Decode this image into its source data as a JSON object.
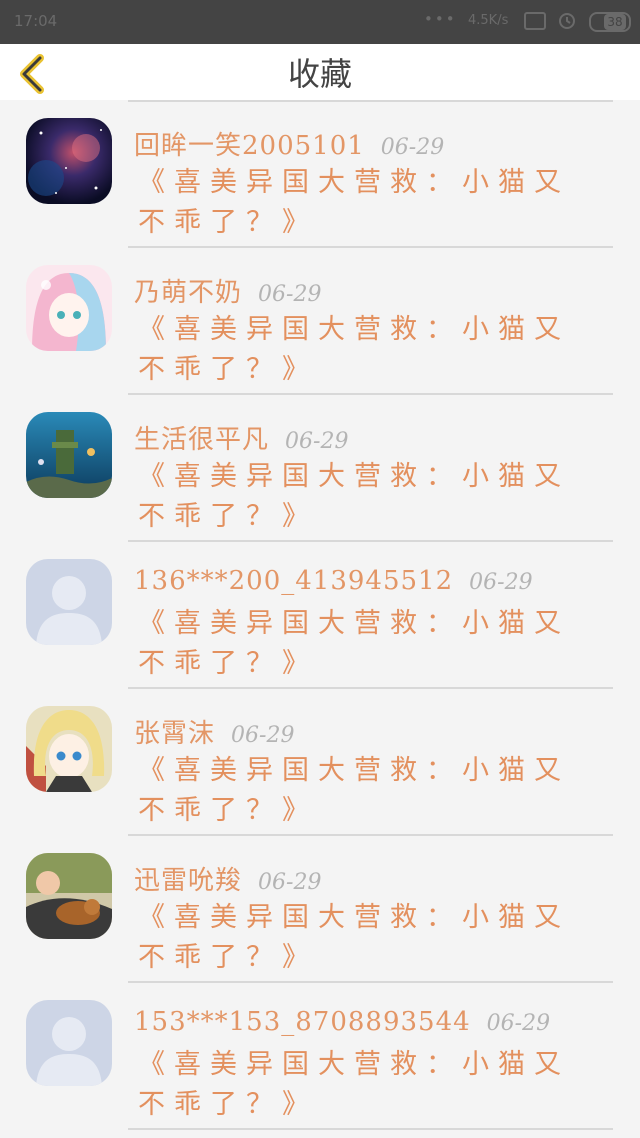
{
  "status": {
    "time": "17:04",
    "dots": "•••",
    "speed": "4.5K/s",
    "battery": "38"
  },
  "header": {
    "title": "收藏"
  },
  "items": [
    {
      "username": "回眸一笑2005101",
      "date": "06-29",
      "content": "《喜美异国大营救：小猫又不乖了？》",
      "avatar": "galaxy"
    },
    {
      "username": "乃萌不奶",
      "date": "06-29",
      "content": "《喜美异国大营救：小猫又不乖了？》",
      "avatar": "anime-pastel"
    },
    {
      "username": "生活很平凡",
      "date": "06-29",
      "content": "《喜美异国大营救：小猫又不乖了？》",
      "avatar": "aquarium"
    },
    {
      "username": "136***200_413945512",
      "date": "06-29",
      "content": "《喜美异国大营救：小猫又不乖了？》",
      "avatar": "default"
    },
    {
      "username": "张霄沫",
      "date": "06-29",
      "content": "《喜美异国大营救：小猫又不乖了？》",
      "avatar": "anime-blonde"
    },
    {
      "username": "迅雷吮羧",
      "date": "06-29",
      "content": "《喜美异国大营救：小猫又不乖了？》",
      "avatar": "baby-dog"
    },
    {
      "username": "153***153_8708893544",
      "date": "06-29",
      "content": "《喜美异国大营救：小猫又不乖了？》",
      "avatar": "default"
    }
  ],
  "colors": {
    "accent": "#e3905e",
    "back_icon": "#e9c231"
  }
}
